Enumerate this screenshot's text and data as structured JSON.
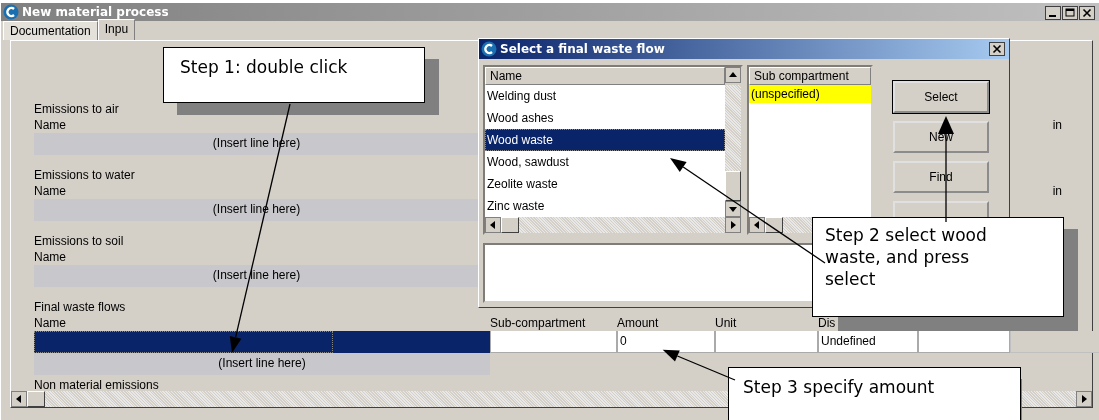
{
  "window": {
    "title": "New material process"
  },
  "tabs": [
    {
      "label": "Documentation",
      "selected": false
    },
    {
      "label": "Inpu",
      "selected": true
    }
  ],
  "sections": [
    {
      "heading": "Emissions to air",
      "name_label": "Name",
      "insert_label": "(Insert line here)",
      "column_label": "in"
    },
    {
      "heading": "Emissions to water",
      "name_label": "Name",
      "insert_label": "(Insert line here)",
      "column_label": "in"
    },
    {
      "heading": "Emissions to soil",
      "name_label": "Name",
      "insert_label": "(Insert line here)"
    }
  ],
  "final_waste": {
    "heading": "Final waste flows",
    "name_label": "Name",
    "columns": [
      "Sub-compartment",
      "Amount",
      "Unit",
      "Dis"
    ],
    "row": {
      "selected": true,
      "cells": [
        "",
        "0",
        "",
        "Undefined"
      ]
    },
    "insert_label": "(Insert line here)"
  },
  "next_section": {
    "heading": "Non material emissions"
  },
  "dialog": {
    "title": "Select a final waste flow",
    "list": {
      "header": "Name",
      "items": [
        {
          "label": "Welding dust",
          "selected": false
        },
        {
          "label": "Wood ashes",
          "selected": false
        },
        {
          "label": "Wood waste",
          "selected": true
        },
        {
          "label": "Wood, sawdust",
          "selected": false
        },
        {
          "label": "Zeolite waste",
          "selected": false
        },
        {
          "label": "Zinc waste",
          "selected": false
        }
      ]
    },
    "sub_list": {
      "header": "Sub compartment",
      "items": [
        {
          "label": "(unspecified)",
          "selected": true
        }
      ]
    },
    "buttons": [
      {
        "kind": "labeled",
        "label": "Select",
        "default": true
      },
      {
        "kind": "labeled",
        "label": "New",
        "default": false
      },
      {
        "kind": "labeled",
        "label": "Find",
        "default": false
      },
      {
        "kind": "covered",
        "default": false
      }
    ]
  },
  "callouts": [
    {
      "text": "Step 1: double click"
    },
    {
      "text": "Step 2 select wood waste, and press select"
    },
    {
      "text": "Step 3 specify amount"
    }
  ]
}
